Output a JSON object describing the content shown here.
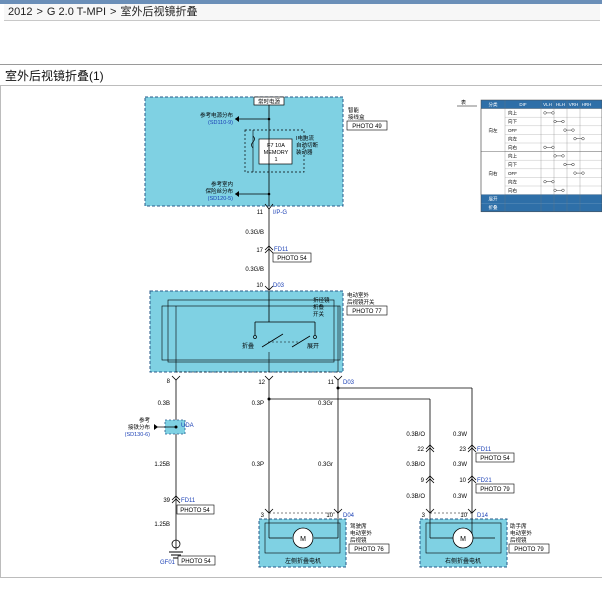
{
  "breadcrumb": {
    "model": "2012",
    "engine": "G 2.0 T-MPI",
    "page": "室外后视镜折叠",
    "sep": ">"
  },
  "section_title": "室外后视镜折叠(1)",
  "top_box": {
    "header": "常时电源",
    "ref_power": "参考电源分布",
    "ref_power_code": "(SD110-9)",
    "fuse_line1": "F7 10A",
    "fuse_line2": "MEMORY",
    "fuse_line3": "1",
    "ifcb_label": "I电电流\n自动切断\n装动器",
    "ref_fuse": "参考室内\n保险丝分布",
    "ref_fuse_code": "(SD120-5)",
    "side_label": "智能\n接线盒",
    "side_photo": "PHOTO 49",
    "pin": "11",
    "pin_conn": "I/P-G"
  },
  "wire_top": {
    "w1": "0.3G/B",
    "pin_fd11": "17",
    "conn_fd11": "FD11",
    "photo_fd11": "PHOTO 54",
    "w2": "0.3G/B",
    "pin_d03": "10",
    "conn_d03": "D03"
  },
  "switch_box": {
    "label": "电动室外\n后视镜开关",
    "photo": "PHOTO 77",
    "inner_label": "折径镜\n折叠\n开关",
    "fold": "折叠",
    "unfold": "展开",
    "pin_left": "8",
    "pin_mid": "12",
    "pin_right": "11",
    "pin_right_conn": "D03"
  },
  "wires_mid": {
    "left": "0.3B",
    "mid": "0.3P",
    "right": "0.3Gr"
  },
  "ground_ref": {
    "label": "参考\n接铁分布",
    "code": "(SD130-6)",
    "conn": "UDA",
    "w": "1.25B",
    "pin": "39",
    "fd11": "FD11",
    "photo": "PHOTO 54",
    "w2": "1.25B",
    "gnd": "GF01",
    "gnd_photo": "PHOTO 54"
  },
  "right_harness": {
    "bo1": "0.3B/O",
    "w1": "0.3W",
    "pin22": "22",
    "pin23": "23",
    "fd11": "FD11",
    "photo1": "PHOTO 54",
    "bo2": "0.3B/O",
    "w2": "0.3W",
    "pin9": "9",
    "pin10": "10",
    "fd21": "FD21",
    "photo2": "PHOTO 79",
    "bo3": "0.3B/O",
    "w3": "0.3W"
  },
  "left_motor": {
    "wire_p": "0.3P",
    "wire_gr": "0.3Gr",
    "pin3": "3",
    "pin10": "10",
    "conn": "D04",
    "label": "驾驶席\n电动室外\n后视镜",
    "photo": "PHOTO 76",
    "bottom": "左侧折叠电机",
    "m": "M"
  },
  "right_motor": {
    "pin3": "3",
    "pin10": "10",
    "conn": "D14",
    "label": "助手席\n电动室外\n后视镜",
    "photo": "PHOTO 79",
    "bottom": "右侧折叠电机",
    "m": "M"
  },
  "table": {
    "headers": [
      "分类",
      "DIF",
      "VLH",
      "HLH",
      "VRH",
      "HRH"
    ],
    "groups": [
      {
        "name": "向左",
        "rows": [
          "向上",
          "向下",
          "OFF",
          "向左",
          "向右"
        ]
      },
      {
        "name": "向右",
        "rows": [
          "向上",
          "向下",
          "OFF",
          "向左",
          "向右"
        ]
      }
    ],
    "bottom_rows": [
      "展开",
      "折叠"
    ],
    "header_color": "#2e6fa8",
    "mark": "表"
  },
  "colors": {
    "box_fill": "#7fd1e3",
    "box_stroke": "#2a5a8a",
    "link": "#1a3fb5",
    "wire": "#000000"
  }
}
